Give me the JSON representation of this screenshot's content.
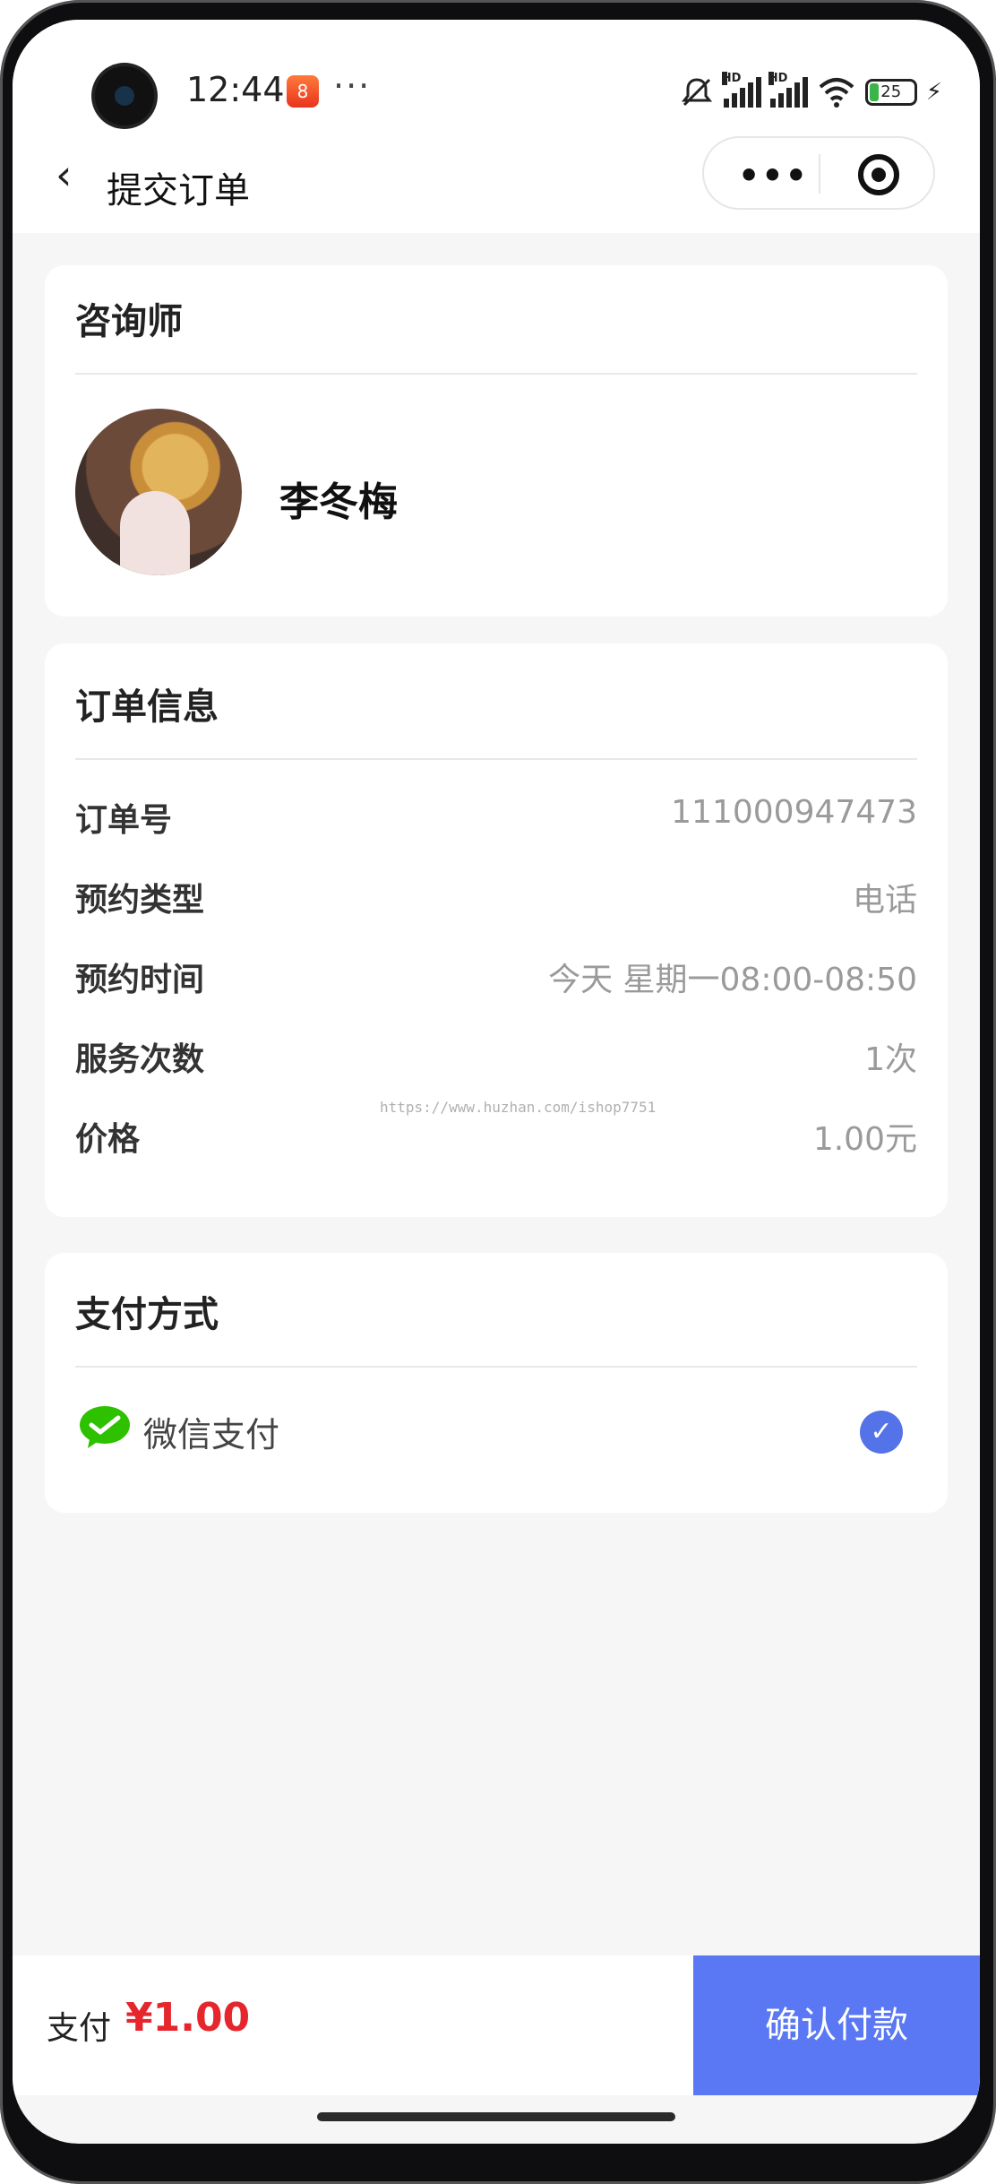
{
  "status_bar": {
    "time": "12:44",
    "app_badge_text": "8",
    "more_dots": "···",
    "battery_level": "25",
    "hd_label": "HD"
  },
  "nav": {
    "back_glyph": "‹",
    "title": "提交订单",
    "capsule_more": "•••"
  },
  "consultant_card": {
    "title": "咨询师",
    "name": "李冬梅"
  },
  "order_card": {
    "title": "订单信息",
    "rows": [
      {
        "label": "订单号",
        "value": "111000947473"
      },
      {
        "label": "预约类型",
        "value": "电话"
      },
      {
        "label": "预约时间",
        "value": "今天 星期一08:00-08:50"
      },
      {
        "label": "服务次数",
        "value": "1次"
      },
      {
        "label": "价格",
        "value": "1.00元"
      }
    ]
  },
  "watermark": "https://www.huzhan.com/ishop7751",
  "payment_card": {
    "title": "支付方式",
    "method": "微信支付",
    "selected": true
  },
  "bottom_bar": {
    "pay_label": "支付",
    "amount": "¥1.00",
    "confirm_label": "确认付款"
  },
  "colors": {
    "accent": "#5a78f3",
    "price": "#e5262d",
    "check": "#5473e8",
    "wechat_green": "#2dc100"
  }
}
